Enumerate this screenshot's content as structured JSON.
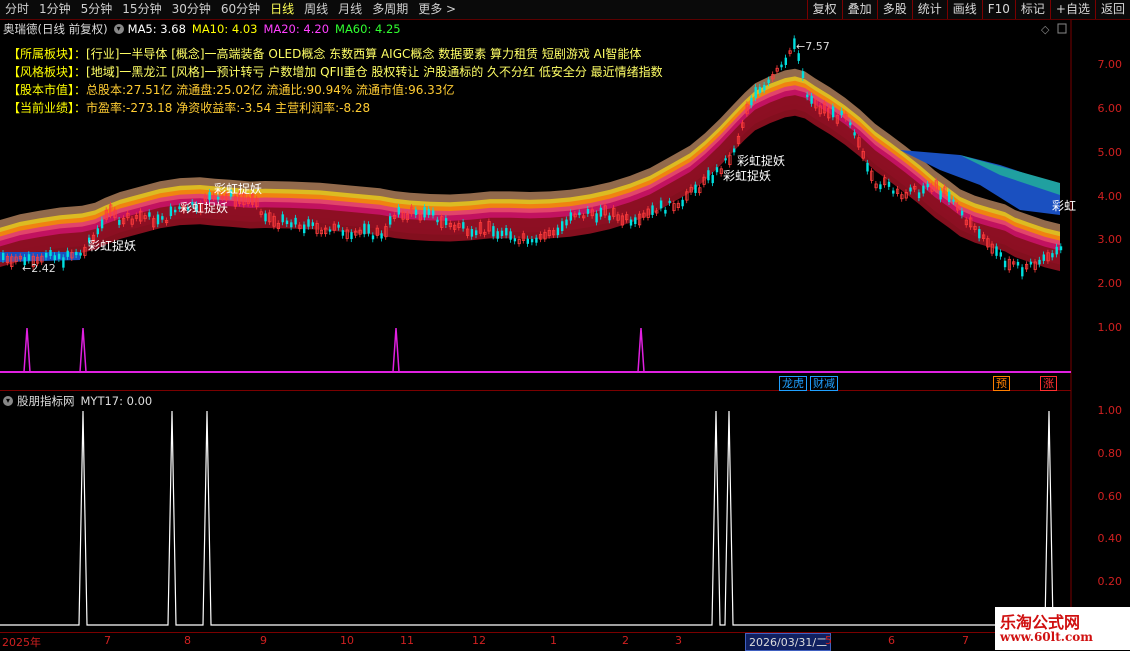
{
  "toolbar": {
    "periods": [
      "分时",
      "1分钟",
      "5分钟",
      "15分钟",
      "30分钟",
      "60分钟",
      "日线",
      "周线",
      "月线",
      "多周期",
      "更多 >"
    ],
    "active_period": "日线",
    "buttons": [
      "复权",
      "叠加",
      "多股",
      "统计",
      "画线",
      "F10",
      "标记",
      "+自选",
      "返回"
    ]
  },
  "main": {
    "title": "奥瑞德(日线 前复权)",
    "ma": [
      {
        "label": "MA5: 3.68",
        "color": "#ffffff"
      },
      {
        "label": "MA10: 4.03",
        "color": "#ffff00"
      },
      {
        "label": "MA20: 4.20",
        "color": "#ff40ff"
      },
      {
        "label": "MA60: 4.25",
        "color": "#30ff30"
      }
    ],
    "info": [
      {
        "key": "【所属板块】：",
        "value": "[行业]一半导体 [概念]一高端装备 OLED概念 东数西算 AIGC概念 数据要素 算力租赁 短剧游戏 AI智能体"
      },
      {
        "key": "【风格板块】：",
        "value": "[地域]一黑龙江 [风格]一预计转亏 户数增加 QFII重仓 股权转让 沪股通标的 久不分红 低安全分 最近情绪指数"
      },
      {
        "key": "【股本市值】：",
        "value": "总股本:27.51亿 流通盘:25.02亿 流通比:90.94% 流通市值:96.33亿"
      },
      {
        "key": "【当前业绩】：",
        "value": "市盈率:-273.18 净资收益率:-3.54 主营利润率:-8.28"
      }
    ],
    "high_label": "7.57",
    "low_label": "2.42",
    "signal_text": "彩虹捉妖",
    "signal_text_last": "彩虹",
    "tags": [
      {
        "text": "龙虎",
        "color": "#20a0ff"
      },
      {
        "text": "财减",
        "color": "#20a0ff"
      },
      {
        "text": "预",
        "color": "#ff8000"
      },
      {
        "text": "涨",
        "color": "#ff3030"
      }
    ]
  },
  "sub": {
    "title": "股朋指标网",
    "indicator": "MYT17: 0.00"
  },
  "axis": {
    "main_y": [
      "7.00",
      "6.00",
      "5.00",
      "4.00",
      "3.00",
      "2.00",
      "1.00"
    ],
    "sub_y": [
      "1.00",
      "0.80",
      "0.60",
      "0.40",
      "0.20"
    ],
    "x": [
      "2025年",
      "7",
      "8",
      "9",
      "10",
      "11",
      "12",
      "1",
      "2",
      "3",
      "4",
      "5",
      "6",
      "7"
    ],
    "current_date": "2026/03/31/二"
  },
  "watermark": {
    "title": "乐淘公式网",
    "url": "www.60lt.com"
  },
  "colors": {
    "up": "#ff3c3c",
    "down": "#00e0e0",
    "axis": "#d02020",
    "signal": "#e020e0",
    "sub_line": "#ffffff"
  }
}
